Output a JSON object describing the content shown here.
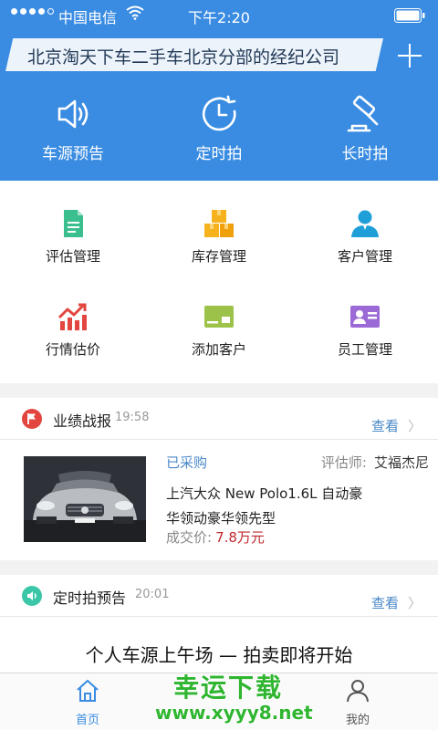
{
  "status_bar": {
    "carrier": "中国电信",
    "time": "下午2:20"
  },
  "header": {
    "title": "北京淘天下车二手车北京分部的经纪公司",
    "add_icon": "plus-icon"
  },
  "quick_actions": [
    {
      "label": "车源预告",
      "icon": "speaker-icon"
    },
    {
      "label": "定时拍",
      "icon": "clock-icon"
    },
    {
      "label": "长时拍",
      "icon": "gavel-icon"
    }
  ],
  "grid": [
    {
      "label": "评估管理",
      "icon": "document-icon",
      "color": "#3cbf8f"
    },
    {
      "label": "库存管理",
      "icon": "boxes-icon",
      "color": "#f5b21d"
    },
    {
      "label": "客户管理",
      "icon": "person-icon",
      "color": "#1f9fd8"
    },
    {
      "label": "行情估价",
      "icon": "trend-icon",
      "color": "#e2463f"
    },
    {
      "label": "添加客户",
      "icon": "card-icon",
      "color": "#9cc24a"
    },
    {
      "label": "员工管理",
      "icon": "id-card-icon",
      "color": "#9b6ad6"
    }
  ],
  "performance": {
    "title": "业绩战报",
    "time": "19:58",
    "more": "查看",
    "item": {
      "status": "已采购",
      "appraiser_label": "评估师:",
      "appraiser": "艾福杰尼",
      "car_name": "上汽大众 New Polo1.6L 自动豪华领动豪华领先型",
      "price_label": "成交价:",
      "price": "7.8万元"
    }
  },
  "timed_preview": {
    "title": "定时拍预告",
    "time": "20:01",
    "more": "查看",
    "headline": "个人车源上午场 — 拍卖即将开始"
  },
  "tabbar": [
    {
      "label": "首页",
      "icon": "home-icon",
      "active": true
    },
    {
      "label": "我的",
      "icon": "user-icon",
      "active": false
    }
  ],
  "watermark": {
    "line1": "幸运下载",
    "line2": "www.xyyy8.net"
  },
  "colors": {
    "primary": "#3a8ce2",
    "price": "#c0282c",
    "link": "#4a88c8"
  }
}
